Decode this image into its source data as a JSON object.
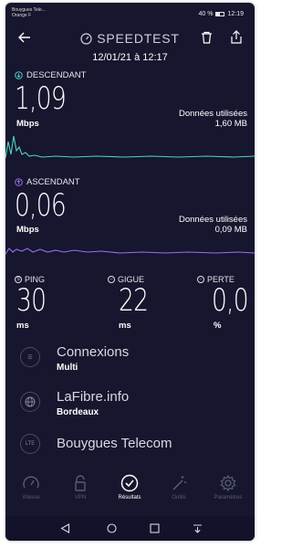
{
  "status_bar": {
    "carrier": "Bouygues Tele...",
    "operator": "Orange F",
    "battery": "40 %",
    "battery_level": 0.4,
    "time": "12:19"
  },
  "header": {
    "title": "SPEEDTEST",
    "datetime": "12/01/21 à 12:17"
  },
  "download": {
    "label": "DESCENDANT",
    "value": "1,09",
    "unit": "Mbps",
    "data_label": "Données utilisées",
    "data_value": "1,60 MB",
    "color": "#4fd1c5"
  },
  "upload": {
    "label": "ASCENDANT",
    "value": "0,06",
    "unit": "Mbps",
    "data_label": "Données utilisées",
    "data_value": "0,09 MB",
    "color": "#9b6cf0"
  },
  "stats": [
    {
      "label": "PING",
      "value": "30",
      "unit": "ms"
    },
    {
      "label": "GIGUE",
      "value": "22",
      "unit": "ms"
    },
    {
      "label": "PERTE",
      "value": "0,0",
      "unit": "%"
    }
  ],
  "info": {
    "connections_title": "Connexions",
    "connections_value": "Multi",
    "server_title": "LaFibre.info",
    "server_value": "Bordeaux",
    "lte_badge": "LTE",
    "provider": "Bouygues Telecom"
  },
  "nav": [
    {
      "label": "Vitesse",
      "icon": "speedometer-icon"
    },
    {
      "label": "VPN",
      "icon": "lock-icon"
    },
    {
      "label": "Résultats",
      "icon": "check-circle-icon",
      "active": true
    },
    {
      "label": "Outils",
      "icon": "magic-wand-icon"
    },
    {
      "label": "Paramètres",
      "icon": "gear-icon"
    }
  ]
}
